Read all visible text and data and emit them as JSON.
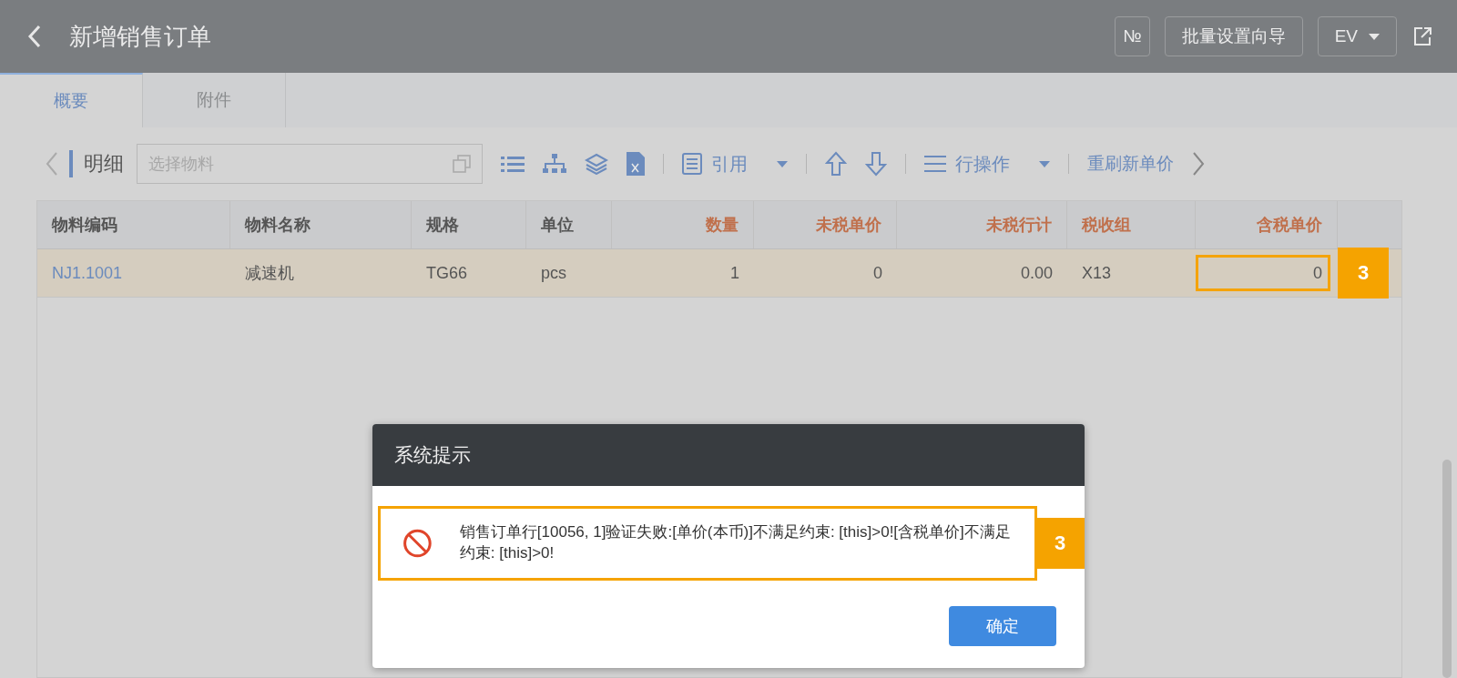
{
  "header": {
    "title": "新增销售订单",
    "buttons": [
      {
        "label": "№",
        "kind": "plain"
      },
      {
        "label": "批量设置向导",
        "kind": "plain"
      },
      {
        "label": "EV",
        "kind": "dropdown"
      }
    ]
  },
  "tabs": [
    {
      "label": "概要",
      "selected": true
    },
    {
      "label": "附件",
      "selected": false
    }
  ],
  "toolbar": {
    "label": "明细",
    "search": {
      "placeholder": "选择物料"
    },
    "reference": "引用",
    "row_ops": "行操作",
    "refresh_price": "重刷新单价"
  },
  "table": {
    "columns": [
      {
        "label": "物料编码",
        "required": false,
        "kind": "text"
      },
      {
        "label": "物料名称",
        "required": false,
        "kind": "text"
      },
      {
        "label": "规格",
        "required": false,
        "kind": "text"
      },
      {
        "label": "单位",
        "required": false,
        "kind": "text"
      },
      {
        "label": "数量",
        "required": true,
        "kind": "number"
      },
      {
        "label": "未税单价",
        "required": true,
        "kind": "number"
      },
      {
        "label": "未税行计",
        "required": true,
        "kind": "number"
      },
      {
        "label": "税收组",
        "required": true,
        "kind": "text"
      },
      {
        "label": "含税单价",
        "required": true,
        "kind": "number"
      }
    ],
    "rows": [
      {
        "selected": true,
        "cells": [
          {
            "text": "NJ1.1001",
            "flagged": false
          },
          {
            "text": "减速机",
            "flagged": false
          },
          {
            "text": "TG66",
            "flagged": false
          },
          {
            "text": "pcs",
            "flagged": false
          },
          {
            "text": "1",
            "flagged": false
          },
          {
            "text": "0",
            "flagged": false
          },
          {
            "text": "0.00",
            "flagged": false
          },
          {
            "text": "X13",
            "flagged": false
          },
          {
            "text": "0",
            "flagged": true
          }
        ],
        "callout": "3"
      }
    ]
  },
  "dialog": {
    "title": "系统提示",
    "message": "销售订单行[10056, 1]验证失败:[单价(本币)]不满足约束: [this]>0![含税单价]不满足约束: [this]>0!",
    "callout": "3",
    "button": "确定"
  }
}
